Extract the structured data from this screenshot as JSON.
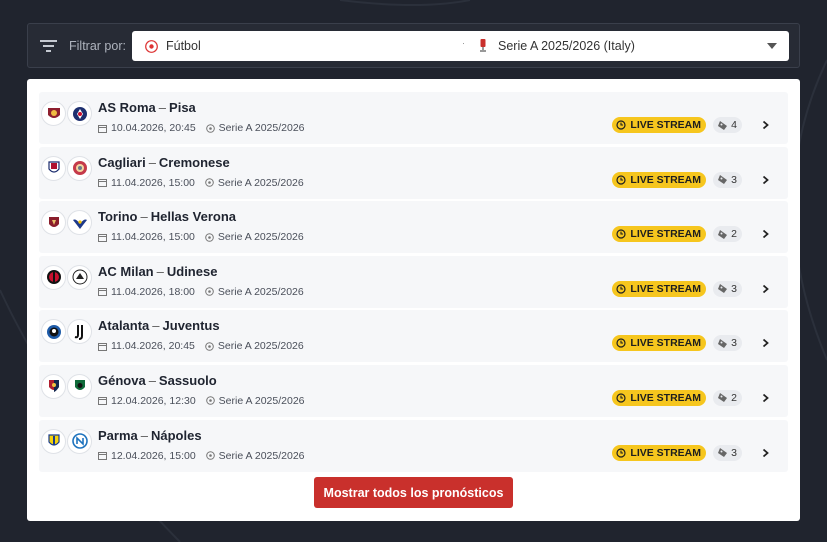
{
  "filter": {
    "label": "Filtrar por:",
    "sport": "Fútbol",
    "league": "Serie A 2025/2026 (Italy)"
  },
  "colors": {
    "accent": "#c9302c",
    "live_badge": "#f6c61e",
    "background": "#20242e"
  },
  "live_label": "LIVE STREAM",
  "matches": [
    {
      "home": "AS Roma",
      "away": "Pisa",
      "sep": "–",
      "datetime": "10.04.2026, 20:45",
      "competition": "Serie A 2025/2026",
      "tips": "4",
      "home_logo": "roma-logo-icon",
      "away_logo": "pisa-logo-icon"
    },
    {
      "home": "Cagliari",
      "away": "Cremonese",
      "sep": "–",
      "datetime": "11.04.2026, 15:00",
      "competition": "Serie A 2025/2026",
      "tips": "3",
      "home_logo": "cagliari-logo-icon",
      "away_logo": "cremonese-logo-icon"
    },
    {
      "home": "Torino",
      "away": "Hellas Verona",
      "sep": "–",
      "datetime": "11.04.2026, 15:00",
      "competition": "Serie A 2025/2026",
      "tips": "2",
      "home_logo": "torino-logo-icon",
      "away_logo": "verona-logo-icon"
    },
    {
      "home": "AC Milan",
      "away": "Udinese",
      "sep": "–",
      "datetime": "11.04.2026, 18:00",
      "competition": "Serie A 2025/2026",
      "tips": "3",
      "home_logo": "milan-logo-icon",
      "away_logo": "udinese-logo-icon"
    },
    {
      "home": "Atalanta",
      "away": "Juventus",
      "sep": "–",
      "datetime": "11.04.2026, 20:45",
      "competition": "Serie A 2025/2026",
      "tips": "3",
      "home_logo": "atalanta-logo-icon",
      "away_logo": "juventus-logo-icon"
    },
    {
      "home": "Génova",
      "away": "Sassuolo",
      "sep": "–",
      "datetime": "12.04.2026, 12:30",
      "competition": "Serie A 2025/2026",
      "tips": "2",
      "home_logo": "genoa-logo-icon",
      "away_logo": "sassuolo-logo-icon"
    },
    {
      "home": "Parma",
      "away": "Nápoles",
      "sep": "–",
      "datetime": "12.04.2026, 15:00",
      "competition": "Serie A 2025/2026",
      "tips": "3",
      "home_logo": "parma-logo-icon",
      "away_logo": "napoli-logo-icon"
    }
  ],
  "show_all_label": "Mostrar todos los pronósticos"
}
